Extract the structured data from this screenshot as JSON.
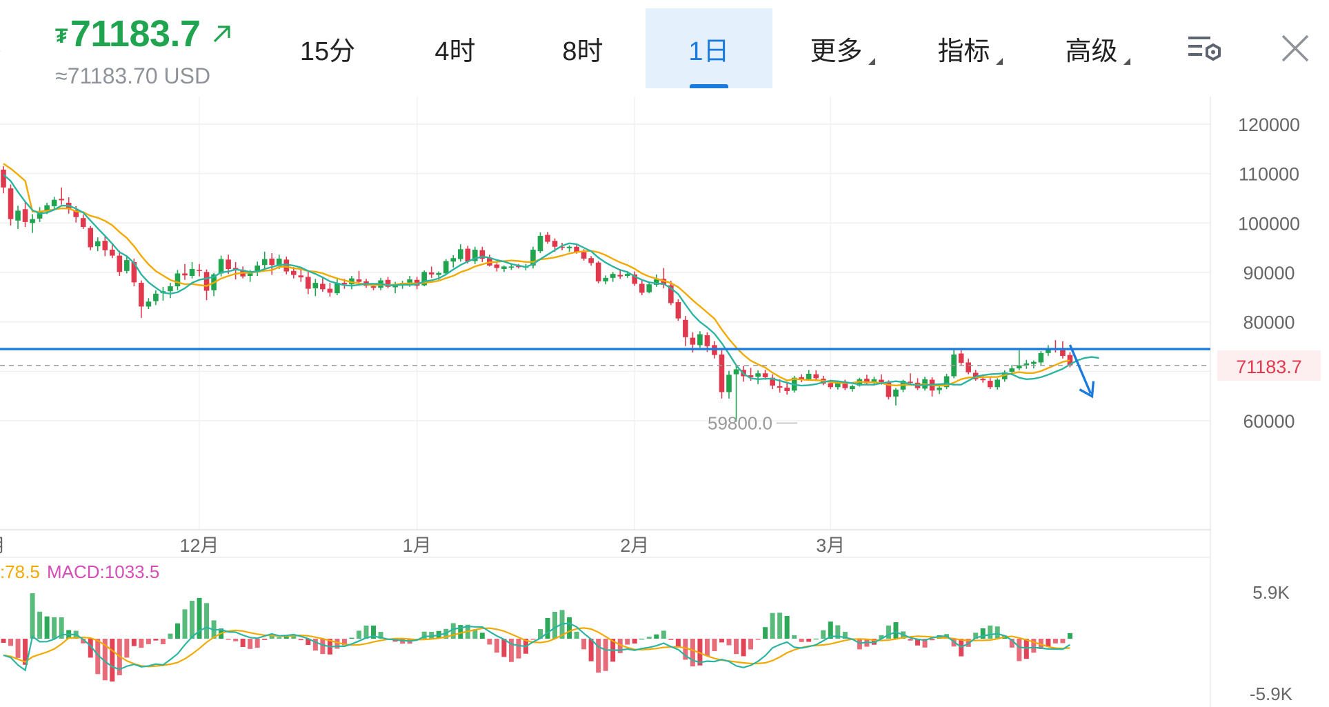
{
  "header": {
    "price": "71183.7",
    "converted": "≈71183.70 USD",
    "currency_glyph": "₮"
  },
  "tabs": [
    {
      "label": "15分",
      "active": false,
      "dropdown": false
    },
    {
      "label": "4时",
      "active": false,
      "dropdown": false
    },
    {
      "label": "8时",
      "active": false,
      "dropdown": false
    },
    {
      "label": "1日",
      "active": true,
      "dropdown": false
    },
    {
      "label": "更多",
      "active": false,
      "dropdown": true
    },
    {
      "label": "指标",
      "active": false,
      "dropdown": true
    },
    {
      "label": "高级",
      "active": false,
      "dropdown": true
    }
  ],
  "icons": {
    "settings": "chart-settings-icon",
    "close": "close-icon",
    "trend": "arrow-up-right-icon"
  },
  "colors": {
    "up": "#21a44f",
    "down": "#e0394d",
    "accent": "#1b7bdc",
    "ma_fast": "#2bb5a0",
    "ma_slow": "#f2a900",
    "macd_text": "#d54db9",
    "price_line": "#1b7bdc"
  },
  "chart_data": [
    {
      "type": "candlestick",
      "x_ticks": [
        "月",
        "12月",
        "1月",
        "2月",
        "3月"
      ],
      "y_ticks": [
        120000,
        110000,
        100000,
        90000,
        80000,
        60000
      ],
      "ylim": [
        58000,
        126000
      ],
      "current_price_label": "71183.7",
      "low_label": "59800.0",
      "horizontal_line": 74500,
      "grid": true,
      "candles_ohlc": [
        [
          110800,
          111500,
          106000,
          107200
        ],
        [
          107000,
          107800,
          99500,
          100800
        ],
        [
          100500,
          103500,
          98800,
          102500
        ],
        [
          102800,
          104200,
          99200,
          100200
        ],
        [
          100000,
          101800,
          98000,
          100800
        ],
        [
          100900,
          103200,
          100200,
          102300
        ],
        [
          102400,
          104100,
          101800,
          103600
        ],
        [
          103400,
          105300,
          102800,
          104700
        ],
        [
          104900,
          107200,
          103700,
          104600
        ],
        [
          104100,
          105200,
          101900,
          102800
        ],
        [
          102600,
          103400,
          100100,
          101200
        ],
        [
          101000,
          101700,
          98800,
          99200
        ],
        [
          99000,
          99400,
          94500,
          95100
        ],
        [
          95300,
          97100,
          94300,
          96300
        ],
        [
          96400,
          97300,
          93300,
          94500
        ],
        [
          94600,
          95900,
          92900,
          93400
        ],
        [
          93400,
          94400,
          89300,
          90100
        ],
        [
          90300,
          93300,
          89800,
          92500
        ],
        [
          92100,
          92800,
          87200,
          88000
        ],
        [
          87900,
          88400,
          80800,
          83100
        ],
        [
          83100,
          84800,
          82600,
          84100
        ],
        [
          84200,
          86400,
          83400,
          85700
        ],
        [
          85800,
          87100,
          84300,
          86200
        ],
        [
          86200,
          87900,
          84800,
          87200
        ],
        [
          87200,
          90500,
          86400,
          89800
        ],
        [
          89800,
          91700,
          88500,
          89400
        ],
        [
          89300,
          92100,
          88800,
          90700
        ],
        [
          90500,
          91700,
          89200,
          90300
        ],
        [
          90100,
          90600,
          84400,
          86300
        ],
        [
          86400,
          89900,
          85200,
          89600
        ],
        [
          89800,
          93400,
          89200,
          92700
        ],
        [
          92600,
          93600,
          89700,
          90700
        ],
        [
          90900,
          92100,
          88600,
          90600
        ],
        [
          90500,
          91200,
          88800,
          89200
        ],
        [
          89300,
          90500,
          88100,
          89900
        ],
        [
          90000,
          92200,
          89300,
          91400
        ],
        [
          91500,
          94200,
          90800,
          92700
        ],
        [
          92800,
          93900,
          89500,
          91500
        ],
        [
          91300,
          93600,
          90700,
          92800
        ],
        [
          92600,
          93200,
          89600,
          90200
        ],
        [
          90300,
          91100,
          88800,
          89500
        ],
        [
          89400,
          90600,
          88100,
          89000
        ],
        [
          89100,
          90400,
          85600,
          86700
        ],
        [
          86800,
          88700,
          85200,
          87900
        ],
        [
          87700,
          89200,
          86100,
          86600
        ],
        [
          86700,
          87900,
          85100,
          85900
        ],
        [
          85800,
          88800,
          85400,
          87900
        ],
        [
          87900,
          88700,
          86700,
          87600
        ],
        [
          87600,
          89300,
          86600,
          88800
        ],
        [
          88600,
          90300,
          87900,
          88100
        ],
        [
          88200,
          88700,
          86900,
          87300
        ],
        [
          87200,
          87800,
          86400,
          86900
        ],
        [
          86900,
          88900,
          86400,
          88400
        ],
        [
          88500,
          89100,
          86800,
          87100
        ],
        [
          87000,
          88100,
          85800,
          87400
        ],
        [
          87600,
          88300,
          86700,
          87900
        ],
        [
          87800,
          89300,
          87100,
          88600
        ],
        [
          88500,
          89100,
          86600,
          87300
        ],
        [
          87400,
          90400,
          87200,
          90100
        ],
        [
          90000,
          91200,
          88900,
          89600
        ],
        [
          89500,
          90200,
          88500,
          89900
        ],
        [
          89800,
          92700,
          89400,
          92300
        ],
        [
          92200,
          93500,
          91000,
          92900
        ],
        [
          92700,
          95700,
          92200,
          94700
        ],
        [
          94800,
          95400,
          91800,
          92200
        ],
        [
          92300,
          95200,
          91700,
          94600
        ],
        [
          94500,
          95200,
          92100,
          92800
        ],
        [
          92900,
          93600,
          91200,
          91400
        ],
        [
          91600,
          91900,
          90200,
          90900
        ],
        [
          90700,
          91400,
          90100,
          91200
        ],
        [
          91000,
          91900,
          90500,
          91200
        ],
        [
          91300,
          91700,
          90800,
          91100
        ],
        [
          91100,
          91700,
          90400,
          91200
        ],
        [
          91400,
          95200,
          90800,
          94600
        ],
        [
          94300,
          98100,
          93900,
          97400
        ],
        [
          97600,
          98200,
          95800,
          96200
        ],
        [
          96400,
          96900,
          94200,
          95200
        ],
        [
          95200,
          96000,
          94500,
          95100
        ],
        [
          94900,
          95500,
          94200,
          95200
        ],
        [
          95200,
          95800,
          93800,
          94100
        ],
        [
          94100,
          94700,
          92400,
          92800
        ],
        [
          92900,
          93300,
          91400,
          91900
        ],
        [
          92000,
          92300,
          87800,
          88200
        ],
        [
          88200,
          89400,
          87600,
          88900
        ],
        [
          88900,
          90100,
          88100,
          89700
        ],
        [
          89500,
          90700,
          88700,
          89200
        ],
        [
          89300,
          90300,
          88900,
          89700
        ],
        [
          89600,
          90200,
          87300,
          87700
        ],
        [
          87700,
          88400,
          85400,
          85900
        ],
        [
          86000,
          87900,
          85800,
          87600
        ],
        [
          87500,
          89600,
          87100,
          88600
        ],
        [
          88700,
          90900,
          86800,
          87500
        ],
        [
          87400,
          88300,
          83400,
          83800
        ],
        [
          84000,
          84600,
          80200,
          80700
        ],
        [
          80400,
          81200,
          75100,
          76900
        ],
        [
          76800,
          77900,
          73800,
          75400
        ],
        [
          75300,
          78100,
          74800,
          77500
        ],
        [
          77300,
          77900,
          73900,
          75100
        ],
        [
          75300,
          76100,
          72600,
          73300
        ],
        [
          73400,
          74300,
          64500,
          65800
        ],
        [
          65800,
          70100,
          64500,
          69300
        ],
        [
          69400,
          71100,
          59800,
          70400
        ],
        [
          70300,
          71100,
          67900,
          69000
        ],
        [
          69200,
          70700,
          68100,
          68800
        ],
        [
          68900,
          70200,
          67400,
          69600
        ],
        [
          69600,
          70300,
          68300,
          68800
        ],
        [
          68700,
          69400,
          66400,
          67100
        ],
        [
          67000,
          68400,
          65700,
          66700
        ],
        [
          66700,
          67600,
          65300,
          66000
        ],
        [
          66100,
          69100,
          65700,
          68700
        ],
        [
          68800,
          69400,
          67800,
          68300
        ],
        [
          68400,
          70300,
          68100,
          69500
        ],
        [
          69400,
          70200,
          68000,
          68600
        ],
        [
          68500,
          69100,
          67200,
          67500
        ],
        [
          67600,
          68300,
          66400,
          66800
        ],
        [
          66800,
          68000,
          66300,
          67600
        ],
        [
          67500,
          68300,
          66200,
          66600
        ],
        [
          66400,
          67300,
          65900,
          67000
        ],
        [
          67100,
          68700,
          66900,
          68400
        ],
        [
          68500,
          69300,
          67400,
          67600
        ],
        [
          67700,
          68900,
          67100,
          68400
        ],
        [
          68300,
          69400,
          67300,
          67800
        ],
        [
          67700,
          68200,
          64300,
          64800
        ],
        [
          64900,
          66600,
          63100,
          66300
        ],
        [
          66300,
          68300,
          65800,
          68100
        ],
        [
          67900,
          69600,
          67300,
          67700
        ],
        [
          67700,
          68600,
          66200,
          66600
        ],
        [
          66500,
          68900,
          66100,
          68400
        ],
        [
          68300,
          68800,
          64900,
          66100
        ],
        [
          66200,
          67100,
          65400,
          66700
        ],
        [
          66800,
          69500,
          66400,
          69000
        ],
        [
          69000,
          74300,
          68600,
          73400
        ],
        [
          73600,
          74700,
          71300,
          71700
        ],
        [
          71800,
          72600,
          69400,
          69800
        ],
        [
          69700,
          70300,
          68100,
          68400
        ],
        [
          68500,
          69400,
          67700,
          68200
        ],
        [
          68100,
          68900,
          66400,
          66800
        ],
        [
          66800,
          68600,
          66300,
          68300
        ],
        [
          68400,
          70200,
          67900,
          69800
        ],
        [
          69900,
          71300,
          69200,
          70600
        ],
        [
          70600,
          74400,
          70200,
          71200
        ],
        [
          71200,
          72300,
          70500,
          71600
        ],
        [
          71500,
          72200,
          70600,
          71900
        ],
        [
          71800,
          74100,
          71300,
          73700
        ],
        [
          73700,
          75300,
          73100,
          74600
        ],
        [
          74600,
          76300,
          73800,
          74300
        ],
        [
          74300,
          76100,
          72600,
          73100
        ],
        [
          73300,
          73900,
          70800,
          71183.7
        ]
      ],
      "ma_fast_values": [
        109800,
        108500,
        106300,
        104300,
        102600,
        101900,
        102100,
        102700,
        103500,
        103500,
        102900,
        102100,
        100500,
        98900,
        97400,
        95800,
        94100,
        93300,
        91900,
        89600,
        88000,
        86900,
        85900,
        85700,
        86000,
        86800,
        87900,
        88500,
        88800,
        89100,
        90000,
        90200,
        90600,
        90400,
        90100,
        90200,
        90700,
        91100,
        91500,
        91600,
        91400,
        91000,
        90300,
        89700,
        89000,
        88200,
        87800,
        87400,
        87300,
        87500,
        87700,
        87700,
        87700,
        87400,
        87400,
        87500,
        87500,
        87600,
        88200,
        88400,
        88800,
        89600,
        90600,
        91500,
        92200,
        92800,
        93200,
        93000,
        92500,
        92200,
        91700,
        91400,
        91100,
        91700,
        92700,
        93600,
        94500,
        95400,
        95900,
        95700,
        95000,
        94300,
        93000,
        92000,
        91200,
        90500,
        90100,
        89200,
        88500,
        88000,
        87800,
        87700,
        86800,
        85600,
        83500,
        81500,
        80000,
        78900,
        77600,
        75700,
        73500,
        71200,
        69500,
        68600,
        68400,
        68500,
        68500,
        68100,
        67700,
        67300,
        67100,
        67200,
        67400,
        67800,
        68100,
        68000,
        67800,
        67600,
        67300,
        67300,
        67300,
        67600,
        67800,
        68000,
        67800,
        67400,
        67200,
        67200,
        67300,
        67400,
        67500,
        67300,
        67300,
        68100,
        68900,
        69200,
        69400,
        69500,
        69600,
        69400,
        68700,
        68400,
        68500,
        68800,
        69300,
        69900,
        70500,
        71400,
        72200,
        72700,
        72900,
        72700
      ]
    },
    {
      "type": "macd",
      "left_label": ":78.5",
      "macd_label": "MACD:1033.5",
      "y_ticks": [
        "5.9K",
        "-5.9K"
      ],
      "ylim": [
        -5900,
        5900
      ]
    }
  ]
}
